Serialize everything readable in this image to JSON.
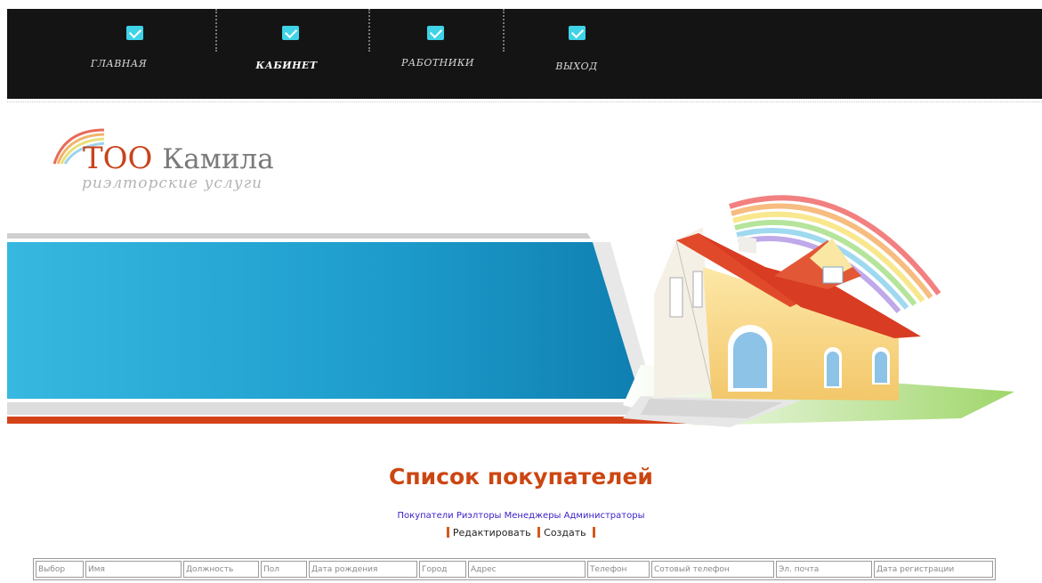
{
  "nav": {
    "items": [
      {
        "label": "ГЛАВНАЯ",
        "active": false
      },
      {
        "label": "КАБИНЕТ",
        "active": true
      },
      {
        "label": "РАБОТНИКИ",
        "active": false
      },
      {
        "label": "ВЫХОД",
        "active": false
      }
    ],
    "icon": "checkmark-icon",
    "background_color": "#141414",
    "icon_color": "#3fd3e8"
  },
  "logo": {
    "title_red": "ТОО",
    "title_grey": "Камила",
    "subtitle": "риэлторские услуги"
  },
  "banner": {
    "colors": {
      "blue": "#1aa3d0",
      "orange": "#d4421a",
      "grey": "#c9c9c9"
    },
    "image": "house-with-rainbow"
  },
  "main": {
    "title": "Список покупателей",
    "role_links": [
      "Покупатели",
      "Риэлторы",
      "Менеджеры",
      "Администраторы"
    ],
    "actions": [
      "Редактировать",
      "Создать"
    ],
    "table": {
      "headers": [
        "Выбор",
        "Имя",
        "Должность",
        "Пол",
        "Дата рождения",
        "Город",
        "Адрес",
        "Телефон",
        "Сотовый телефон",
        "Эл. почта",
        "Дата регистрации"
      ]
    }
  },
  "colors": {
    "accent": "#cc4612",
    "link": "#3a23c8"
  }
}
